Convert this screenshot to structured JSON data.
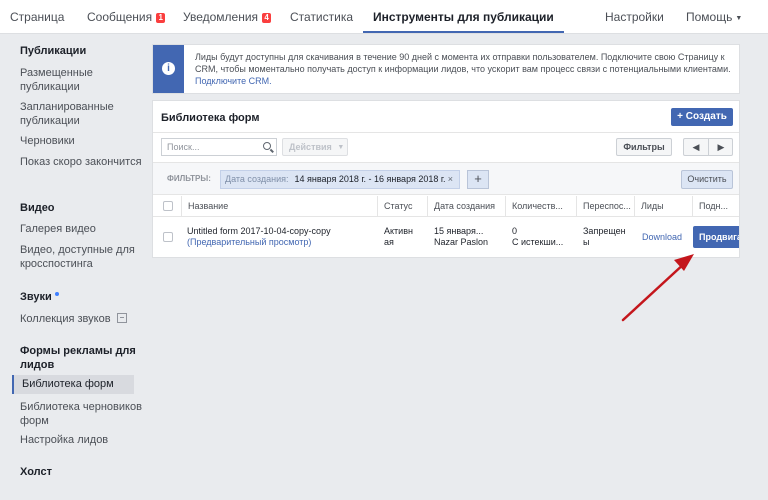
{
  "topnav": {
    "tabs": [
      {
        "label": "Страница"
      },
      {
        "label": "Сообщения",
        "badge": "1"
      },
      {
        "label": "Уведомления",
        "badge": "4"
      },
      {
        "label": "Статистика"
      },
      {
        "label": "Инструменты для публикации",
        "active": true
      }
    ],
    "settings": "Настройки",
    "help": "Помощь"
  },
  "sidebar": {
    "publications": {
      "heading": "Публикации",
      "items": [
        "Размещенные публикации",
        "Запланированные публикации",
        "Черновики",
        "Показ скоро закончится"
      ]
    },
    "video": {
      "heading": "Видео",
      "items": [
        "Галерея видео",
        "Видео, доступные для кросспостинга"
      ]
    },
    "sounds": {
      "heading": "Звуки",
      "items": [
        "Коллекция звуков"
      ]
    },
    "leads": {
      "heading": "Формы рекламы для лидов",
      "items": [
        "Библиотека форм",
        "Библиотека черновиков форм",
        "Настройка лидов"
      ]
    },
    "canvas": {
      "heading": "Холст"
    }
  },
  "notice": {
    "text": "Лиды будут доступны для скачивания в течение 90 дней с момента их отправки пользователем. Подключите свою Страницу к CRM, чтобы моментально получать доступ к информации лидов, что ускорит вам процесс связи с потенциальными клиентами.",
    "link": "Подключите CRM."
  },
  "library": {
    "title": "Библиотека форм",
    "create_label": "+ Создать",
    "search_placeholder": "Поиск...",
    "actions_label": "Действия",
    "filters_button": "Фильтры",
    "filters_label": "ФИЛЬТРЫ:",
    "filter_chip": {
      "key": "Дата создания:",
      "value": "14 января 2018 г. - 16 января 2018 г.",
      "remove": "×"
    },
    "clear_label": "Очистить",
    "columns": [
      "Название",
      "Статус",
      "Дата создания",
      "Количеств...",
      "Переспос...",
      "Лиды",
      "Подн..."
    ],
    "rows": [
      {
        "name": "Untitled form 2017-10-04-copy-copy",
        "preview": "Предварительный просмотр",
        "status_line1": "Активн",
        "status_line2": "ая",
        "date_line1": "15 января...",
        "date_line2": "Nazar Paslon",
        "count_line1": "0",
        "count_line2": "С истекши...",
        "resend_line1": "Запрещен",
        "resend_line2": "ы",
        "leads_link": "Download",
        "promote_label": "Продвигать"
      }
    ]
  },
  "colors": {
    "brand_blue": "#4267b2",
    "annotation_arrow": "#c4161c",
    "badge_red": "#fa3e3e"
  }
}
